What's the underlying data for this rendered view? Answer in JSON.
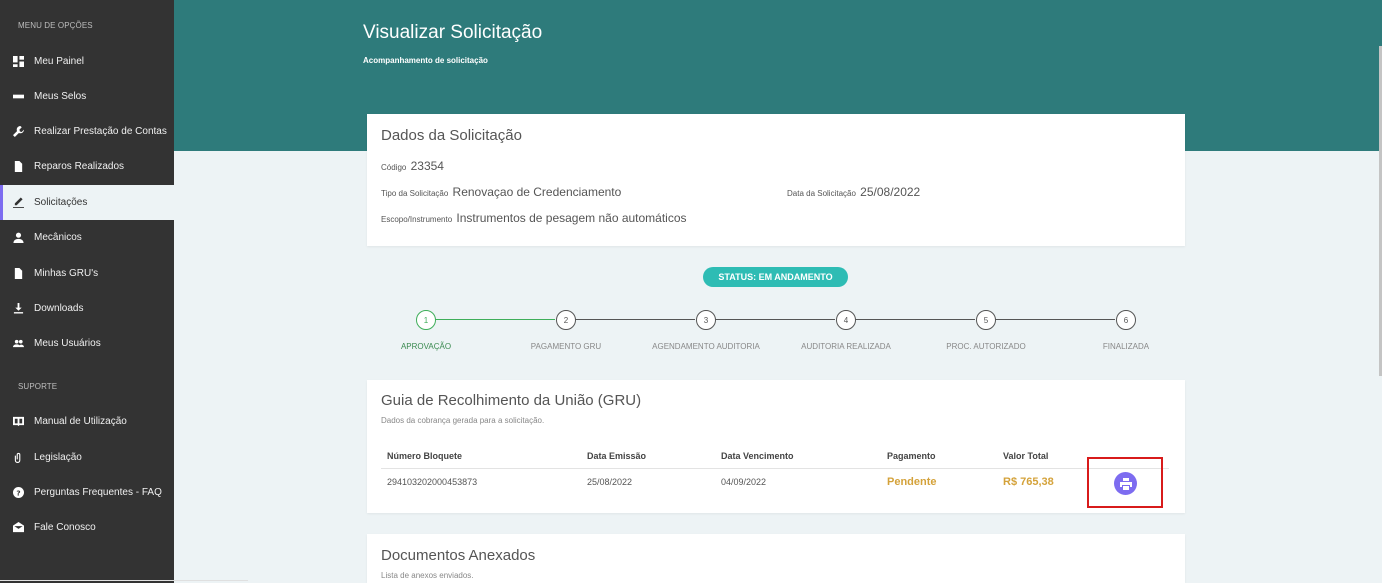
{
  "sidebar": {
    "menu_label": "MENU DE OPÇÕES",
    "support_label": "SUPORTE",
    "items": [
      {
        "label": "Meu Painel",
        "icon": "dashboard-icon"
      },
      {
        "label": "Meus Selos",
        "icon": "seal-icon"
      },
      {
        "label": "Realizar Prestação de Contas",
        "icon": "wrench-icon"
      },
      {
        "label": "Reparos Realizados",
        "icon": "document-icon"
      },
      {
        "label": "Solicitações",
        "icon": "edit-icon"
      },
      {
        "label": "Mecânicos",
        "icon": "person-icon"
      },
      {
        "label": "Minhas GRU's",
        "icon": "file-icon"
      },
      {
        "label": "Downloads",
        "icon": "download-icon"
      },
      {
        "label": "Meus Usuários",
        "icon": "users-icon"
      }
    ],
    "support_items": [
      {
        "label": "Manual de Utilização",
        "icon": "book-icon"
      },
      {
        "label": "Legislação",
        "icon": "clip-icon"
      },
      {
        "label": "Perguntas Frequentes - FAQ",
        "icon": "help-icon"
      },
      {
        "label": "Fale Conosco",
        "icon": "mail-icon"
      }
    ]
  },
  "header": {
    "title": "Visualizar Solicitação",
    "subtitle": "Acompanhamento de solicitação"
  },
  "dados": {
    "title": "Dados da Solicitação",
    "codigo_label": "Código",
    "codigo_value": "23354",
    "tipo_label": "Tipo da Solicitação",
    "tipo_value": "Renovaçao de Credenciamento",
    "data_label": "Data da Solicitação",
    "data_value": "25/08/2022",
    "escopo_label": "Escopo/Instrumento",
    "escopo_value": "Instrumentos de pesagem não automáticos"
  },
  "status": "STATUS: EM ANDAMENTO",
  "steps": [
    {
      "num": "1",
      "label": "APROVAÇÃO"
    },
    {
      "num": "2",
      "label": "PAGAMENTO GRU"
    },
    {
      "num": "3",
      "label": "AGENDAMENTO AUDITORIA"
    },
    {
      "num": "4",
      "label": "AUDITORIA REALIZADA"
    },
    {
      "num": "5",
      "label": "PROC. AUTORIZADO"
    },
    {
      "num": "6",
      "label": "FINALIZADA"
    }
  ],
  "gru": {
    "title": "Guia de Recolhimento da União (GRU)",
    "subtitle": "Dados da cobrança gerada para a solicitação.",
    "columns": [
      "Número Bloquete",
      "Data Emissão",
      "Data Vencimento",
      "Pagamento",
      "Valor Total"
    ],
    "row": {
      "numero": "294103202000453873",
      "emissao": "25/08/2022",
      "vencimento": "04/09/2022",
      "pagamento": "Pendente",
      "valor": "R$ 765,38"
    },
    "print_icon": "print-icon"
  },
  "anexos": {
    "title": "Documentos Anexados",
    "subtitle": "Lista de anexos enviados."
  },
  "colors": {
    "header": "#2e7b7b",
    "sidebar": "#333333",
    "accent": "#7d6cf0",
    "status": "#2ebcb4",
    "step_done": "#3fae5a",
    "pending": "#d4a23a",
    "highlight_box": "#d81b1b"
  }
}
